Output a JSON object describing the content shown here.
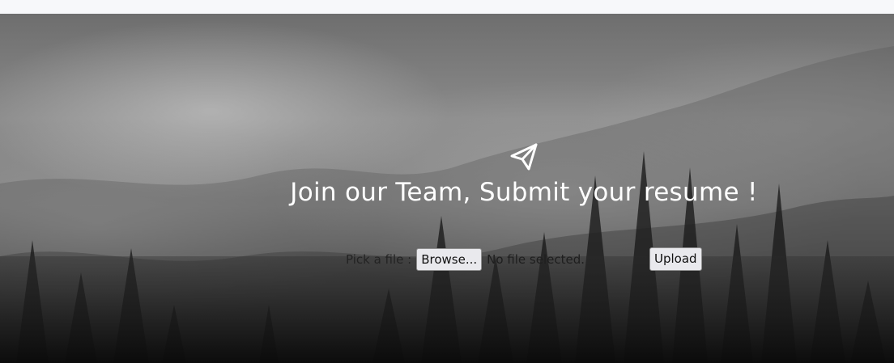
{
  "hero": {
    "title": "Join our Team, Submit your resume !",
    "icon": "paper-plane-icon"
  },
  "upload_form": {
    "pick_label": "Pick a file :",
    "browse_label": "Browse...",
    "file_status": "No file selected.",
    "upload_label": "Upload"
  },
  "colors": {
    "title_text": "#ffffff",
    "topbar": "#f7f8fa",
    "button_bg": "#e9e9ed"
  }
}
